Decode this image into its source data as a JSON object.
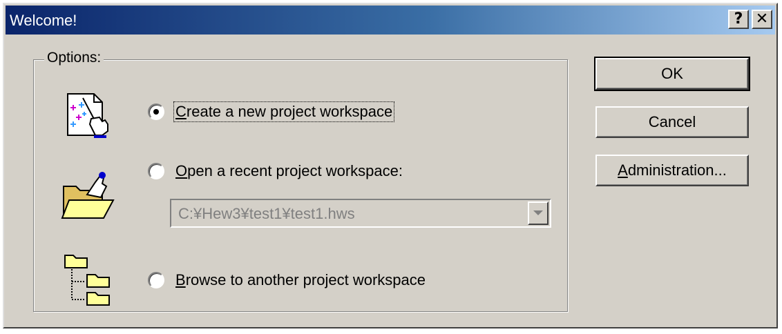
{
  "window": {
    "title": "Welcome!",
    "help_button": "?",
    "close_button": "✕"
  },
  "options": {
    "group_label": "Options:",
    "create_new": {
      "label_accel": "C",
      "label_rest": "reate a new project workspace",
      "selected": true,
      "icon": "new-project-icon"
    },
    "open_recent": {
      "label_accel": "O",
      "label_rest": "pen a recent project workspace:",
      "selected": false,
      "icon": "open-folder-icon",
      "recent_value": "C:¥Hew3¥test1¥test1.hws",
      "enabled": false
    },
    "browse": {
      "label_accel": "B",
      "label_rest": "rowse to another project workspace",
      "selected": false,
      "icon": "folder-tree-icon"
    }
  },
  "buttons": {
    "ok": "OK",
    "cancel": "Cancel",
    "admin_accel": "A",
    "admin_rest": "dministration..."
  },
  "colors": {
    "dialog_face": "#d4d0c8",
    "title_gradient_start": "#0a246a",
    "title_gradient_end": "#a6caf0",
    "disabled_text": "#808080"
  }
}
